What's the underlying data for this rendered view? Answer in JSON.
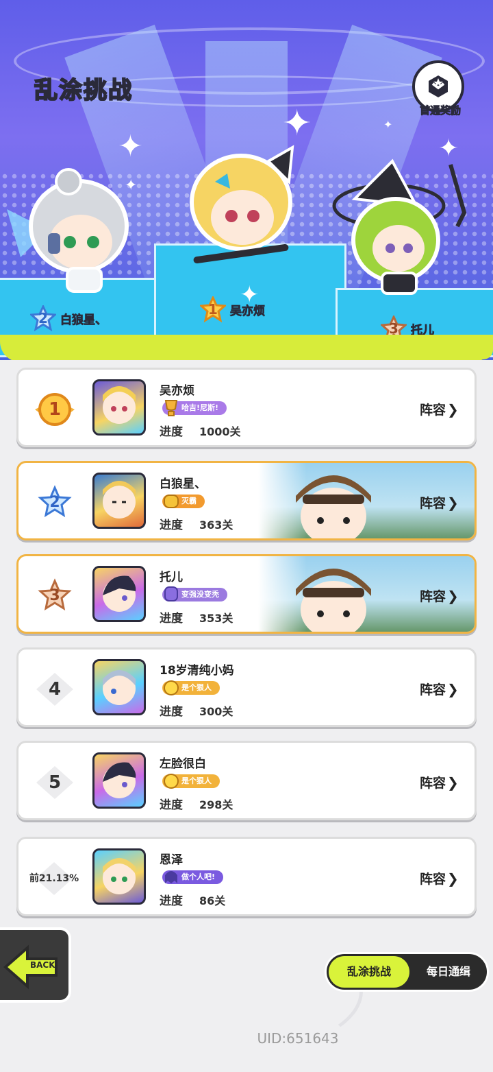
{
  "header": {
    "title": "乱涂挑战",
    "reward_label": "首通奖励"
  },
  "podium": [
    {
      "rank": "2",
      "name": "白狼星、"
    },
    {
      "rank": "1",
      "name": "吴亦烦"
    },
    {
      "rank": "3",
      "name": "托儿"
    }
  ],
  "leaderboard": {
    "progress_label": "进度",
    "lineup_label": "阵容",
    "rows": [
      {
        "rank": "1",
        "name": "吴亦烦",
        "badge": "哈吉!尼斯!",
        "progress": "1000关"
      },
      {
        "rank": "2",
        "name": "白狼星、",
        "badge": "灭霸",
        "progress": "363关"
      },
      {
        "rank": "3",
        "name": "托儿",
        "badge": "变强没变秃",
        "progress": "353关"
      },
      {
        "rank": "4",
        "name": "18岁清纯小妈",
        "badge": "是个狠人",
        "progress": "300关"
      },
      {
        "rank": "5",
        "name": "左脸很白",
        "badge": "是个狠人",
        "progress": "298关"
      },
      {
        "rank": "前21.13%",
        "name": "恩泽",
        "badge": "做个人吧!",
        "progress": "86关"
      }
    ]
  },
  "footer": {
    "back_label": "BACK",
    "tabs": [
      "乱涂挑战",
      "每日通缉"
    ],
    "uid": "UID:651643"
  },
  "colors": {
    "header_bg": "#6d6ce8",
    "slime": "#d7ec3a",
    "gold_border": "#f1b444",
    "tab_active": "#d9f33a"
  }
}
